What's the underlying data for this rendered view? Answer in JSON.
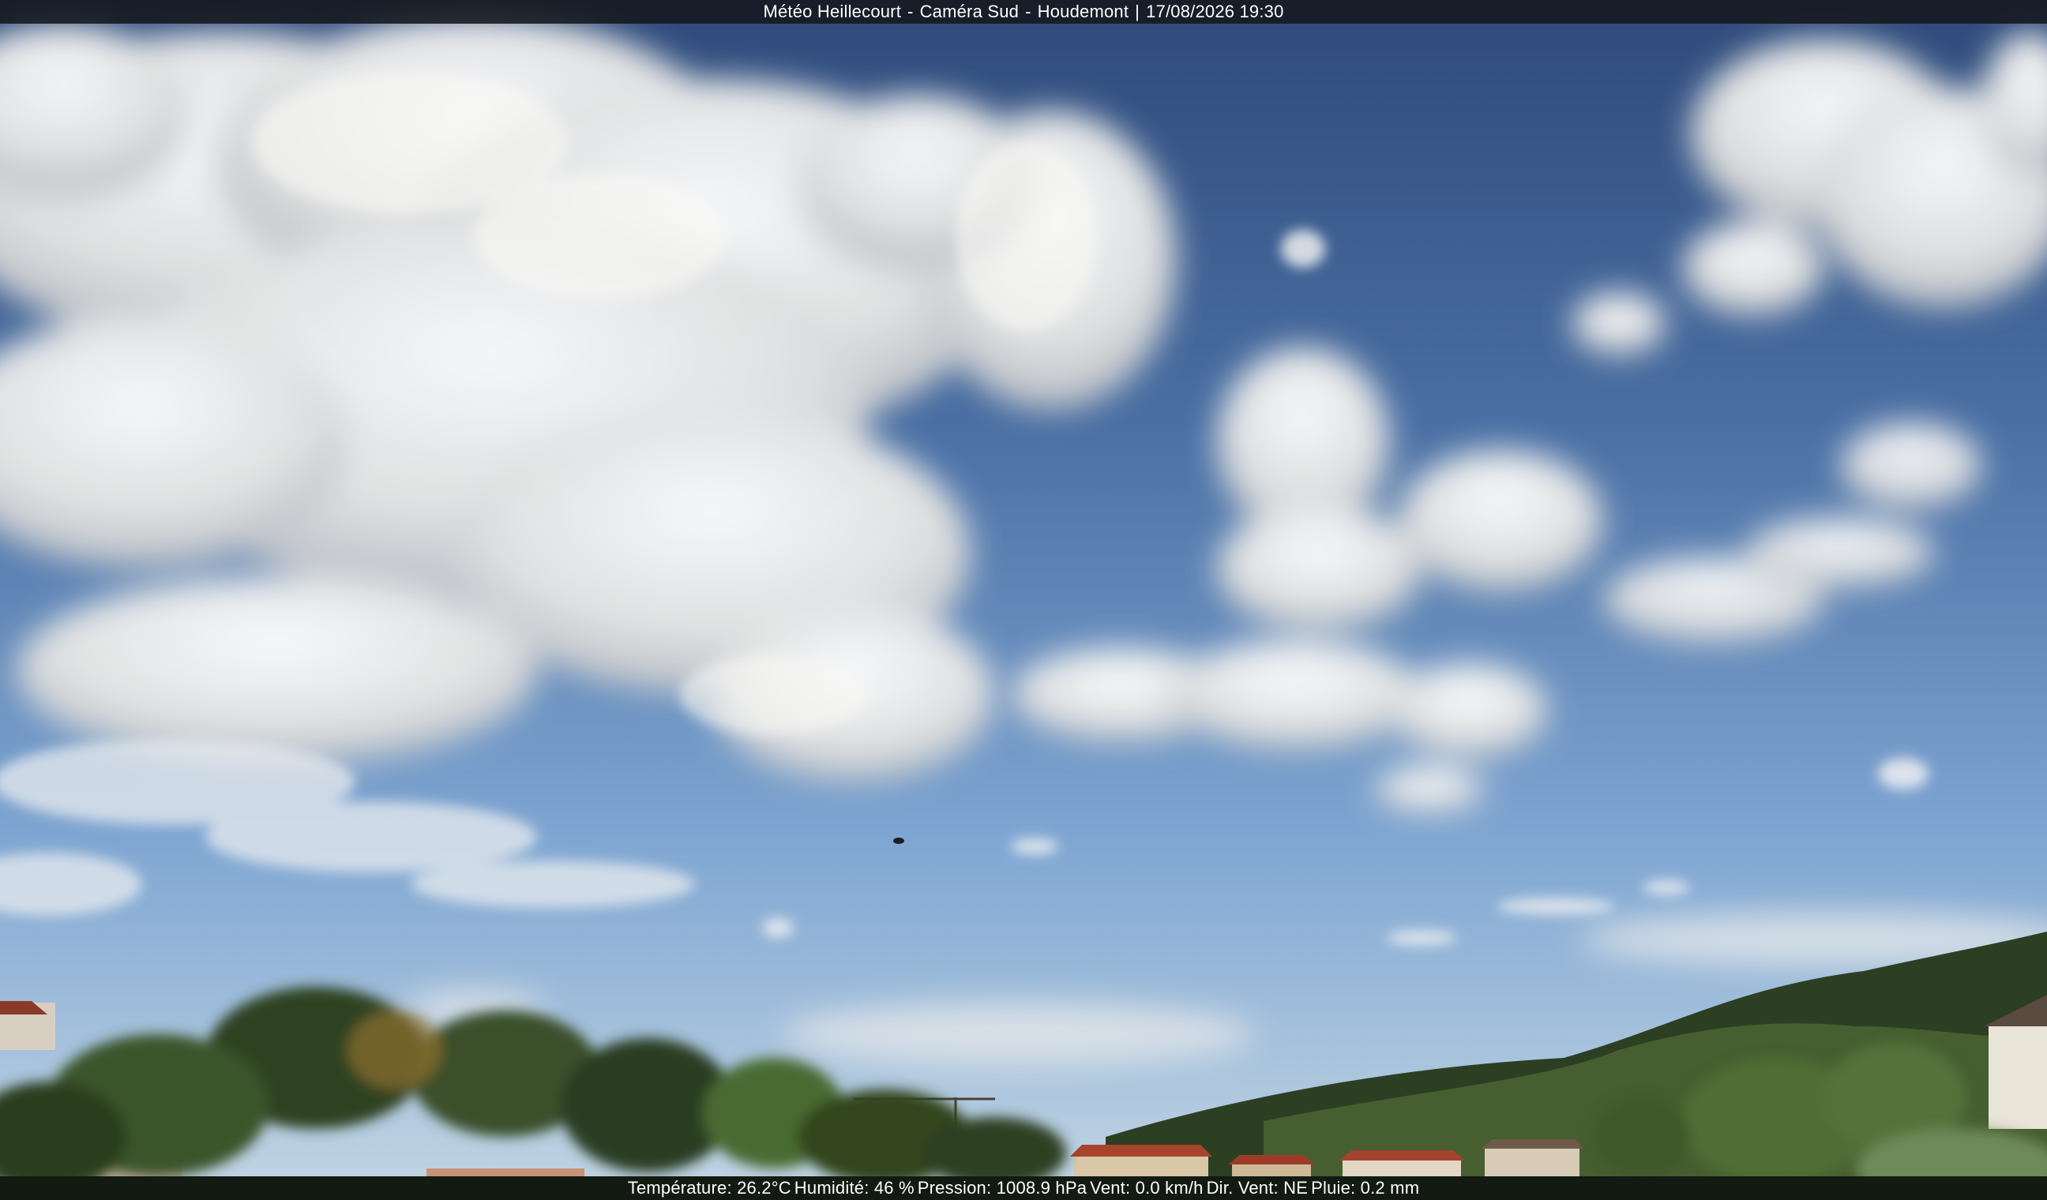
{
  "header": {
    "site": "Météo Heillecourt",
    "camera": "Caméra Sud",
    "location": "Houdemont",
    "datetime": "17/08/2026 19:30",
    "separator_dash": "-",
    "separator_pipe": "|"
  },
  "footer": {
    "temperature": "Température: 26.2°C",
    "humidity": "Humidité: 46 %",
    "pressure": "Pression: 1008.9 hPa",
    "wind": "Vent: 0.0 km/h",
    "wind_dir": "Dir. Vent: NE",
    "rain": "Pluie: 0.2 mm"
  },
  "colors": {
    "sky_top": "#2f4e80",
    "sky_mid": "#5d86bd",
    "sky_horizon": "#b9cfe0",
    "cloud": "#f4f3ef",
    "trees_dark": "#1f2e19",
    "trees_mid": "#3f5a2a",
    "bar": "#14181e"
  }
}
